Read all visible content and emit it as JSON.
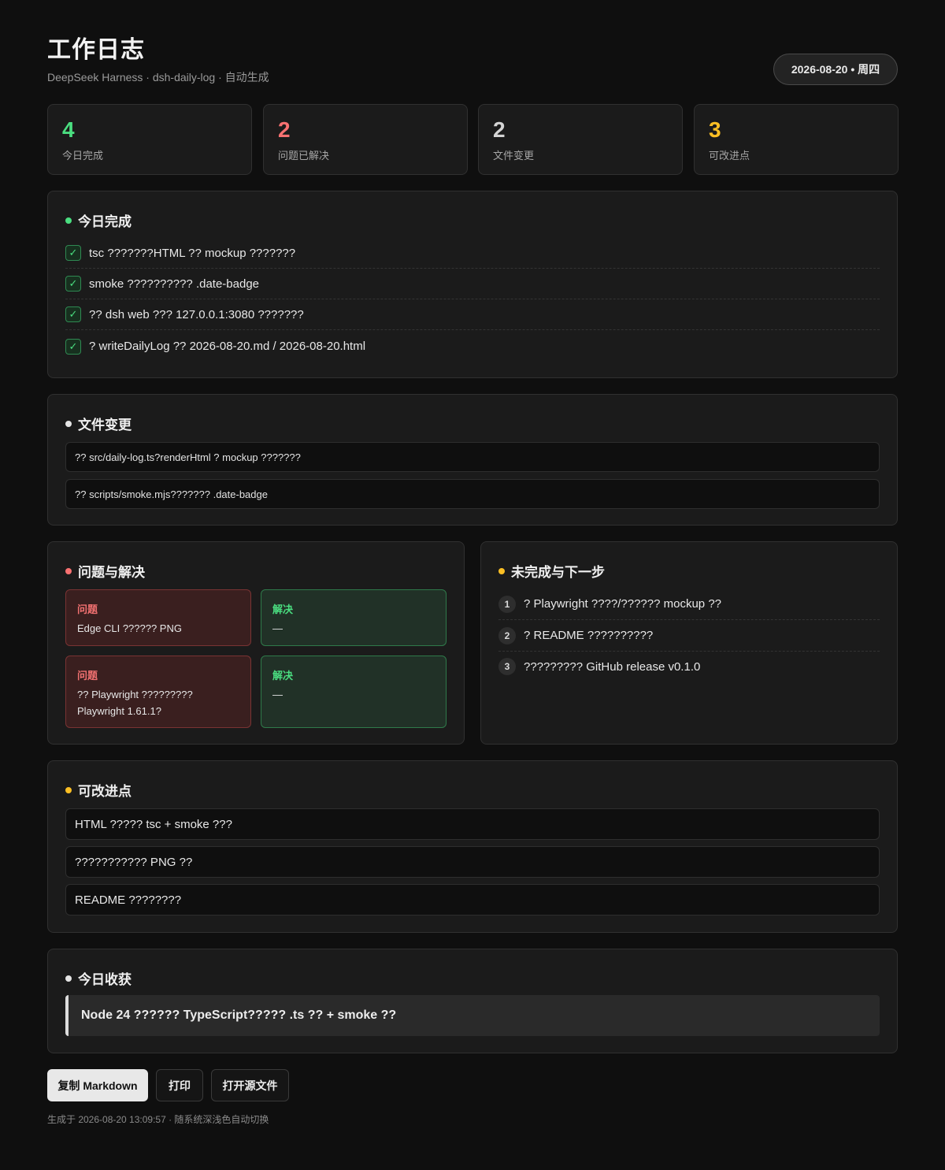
{
  "header": {
    "title": "工作日志",
    "subtitle": "DeepSeek Harness · dsh-daily-log · 自动生成",
    "date_badge": "2026-08-20 • 周四"
  },
  "stats": [
    {
      "value": "4",
      "label": "今日完成",
      "color": "#4ade80"
    },
    {
      "value": "2",
      "label": "问题已解决",
      "color": "#f87171"
    },
    {
      "value": "2",
      "label": "文件变更",
      "color": "#d4d4d4"
    },
    {
      "value": "3",
      "label": "可改进点",
      "color": "#fbbf24"
    }
  ],
  "done": {
    "title": "今日完成",
    "dot_color": "#4ade80",
    "check_glyph": "✓",
    "items": [
      "tsc ???????HTML ?? mockup ???????",
      "smoke ?????????? .date-badge",
      "?? dsh web ??? 127.0.0.1:3080 ???????",
      "? writeDailyLog ?? 2026-08-20.md / 2026-08-20.html"
    ]
  },
  "files": {
    "title": "文件变更",
    "dot_color": "#e5e5e5",
    "items": [
      "?? src/daily-log.ts?renderHtml ? mockup ???????",
      "?? scripts/smoke.mjs??????? .date-badge"
    ]
  },
  "issues": {
    "title": "问题与解决",
    "dot_color": "#f87171",
    "problem_label": "问题",
    "solution_label": "解决",
    "items": [
      {
        "problem": "Edge CLI ?????? PNG",
        "solution": "—"
      },
      {
        "problem": "?? Playwright ????????? Playwright 1.61.1?",
        "solution": "—"
      }
    ]
  },
  "next": {
    "title": "未完成与下一步",
    "dot_color": "#fbbf24",
    "items": [
      {
        "n": "1",
        "text": "? Playwright ????/?????? mockup ??"
      },
      {
        "n": "2",
        "text": "? README ??????????"
      },
      {
        "n": "3",
        "text": "????????? GitHub release v0.1.0"
      }
    ]
  },
  "improve": {
    "title": "可改进点",
    "dot_color": "#fbbf24",
    "items": [
      "HTML ????? tsc + smoke ???",
      "??????????? PNG ??",
      "README ????????"
    ]
  },
  "learned": {
    "title": "今日收获",
    "dot_color": "#e5e5e5",
    "text": "Node 24 ?????? TypeScript????? .ts ?? + smoke ??"
  },
  "buttons": {
    "copy_md": "复制 Markdown",
    "print": "打印",
    "open_source": "打开源文件"
  },
  "footer": "生成于 2026-08-20 13:09:57 · 随系统深浅色自动切换"
}
